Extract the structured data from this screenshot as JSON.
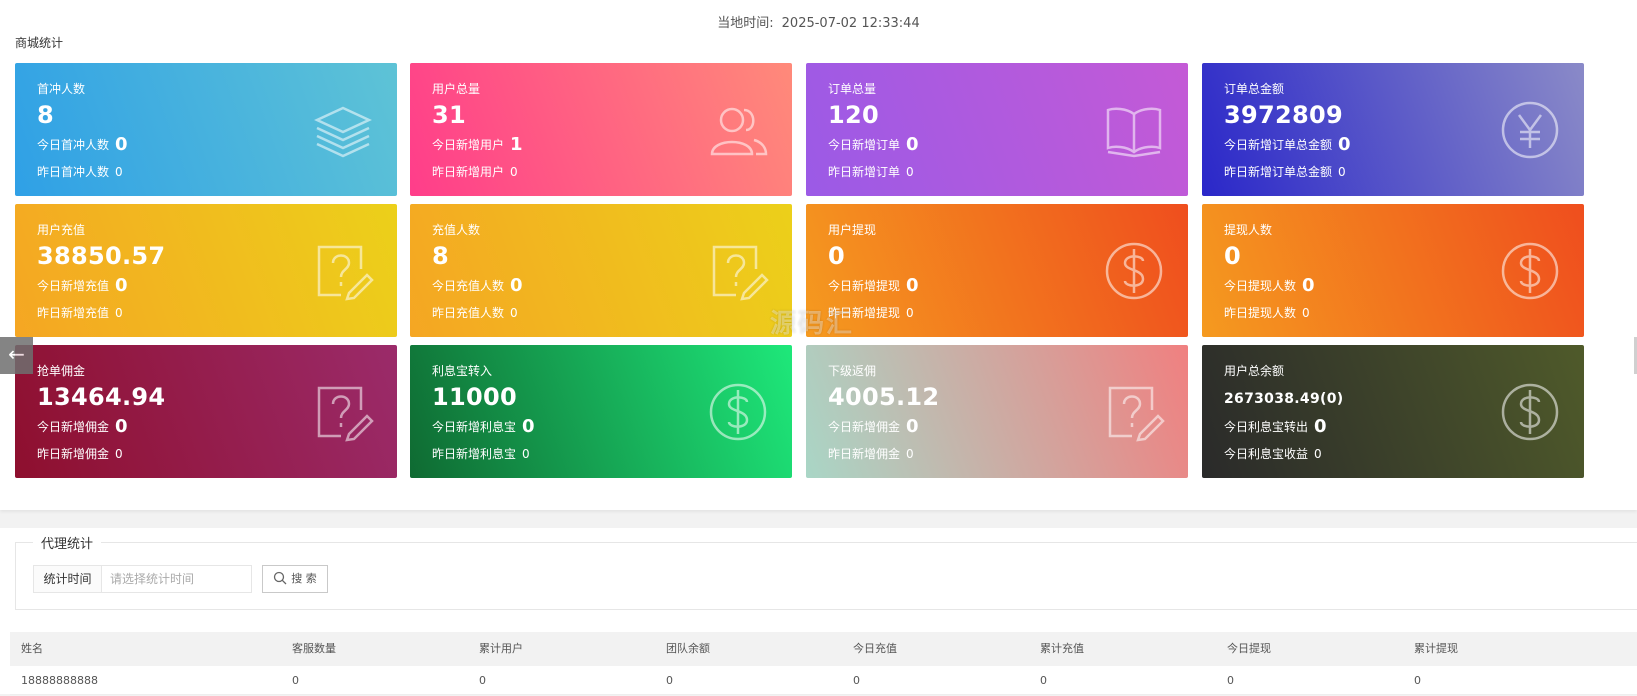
{
  "header": {
    "local_time_label": "当地时间:",
    "local_time_value": "2025-07-02 12:33:44",
    "section_title": "商城统计"
  },
  "cards": [
    {
      "title": "首冲人数",
      "value": "8",
      "line1_label": "今日首冲人数",
      "line1_value": "0",
      "line2_label": "昨日首冲人数",
      "line2_value": "0",
      "icon": "layers-icon",
      "gradient": [
        "#2fa0e6",
        "#5ec3d6"
      ]
    },
    {
      "title": "用户总量",
      "value": "31",
      "line1_label": "今日新增用户",
      "line1_value": "1",
      "line2_label": "昨日新增用户",
      "line2_value": "0",
      "icon": "users-icon",
      "gradient": [
        "#ff3d8a",
        "#ff8a7a"
      ]
    },
    {
      "title": "订单总量",
      "value": "120",
      "line1_label": "今日新增订单",
      "line1_value": "0",
      "line2_label": "昨日新增订单",
      "line2_value": "0",
      "icon": "book-icon",
      "gradient": [
        "#9b5ae6",
        "#c45ad6"
      ]
    },
    {
      "title": "订单总金额",
      "value": "3972809",
      "line1_label": "今日新增订单总金额",
      "line1_value": "0",
      "line2_label": "昨日新增订单总金额",
      "line2_value": "0",
      "icon": "yen-icon",
      "gradient": [
        "#2a27c9",
        "#8a8ac8"
      ]
    },
    {
      "title": "用户充值",
      "value": "38850.57",
      "line1_label": "今日新增充值",
      "line1_value": "0",
      "line2_label": "昨日新增充值",
      "line2_value": "0",
      "icon": "question-edit-icon",
      "gradient": [
        "#f5a623",
        "#ecd01a"
      ]
    },
    {
      "title": "充值人数",
      "value": "8",
      "line1_label": "今日充值人数",
      "line1_value": "0",
      "line2_label": "昨日充值人数",
      "line2_value": "0",
      "icon": "question-edit-icon",
      "gradient": [
        "#f5a623",
        "#ecd01a"
      ]
    },
    {
      "title": "用户提现",
      "value": "0",
      "line1_label": "今日新增提现",
      "line1_value": "0",
      "line2_label": "昨日新增提现",
      "line2_value": "0",
      "icon": "dollar-icon",
      "gradient": [
        "#f59a1f",
        "#ef4e1e"
      ]
    },
    {
      "title": "提现人数",
      "value": "0",
      "line1_label": "今日提现人数",
      "line1_value": "0",
      "line2_label": "昨日提现人数",
      "line2_value": "0",
      "icon": "dollar-icon",
      "gradient": [
        "#f59a1f",
        "#ef4e1e"
      ]
    },
    {
      "title": "抢单佣金",
      "value": "13464.94",
      "line1_label": "今日新增佣金",
      "line1_value": "0",
      "line2_label": "昨日新增佣金",
      "line2_value": "0",
      "icon": "question-edit-icon",
      "gradient": [
        "#8e0f2e",
        "#9b2b6a"
      ]
    },
    {
      "title": "利息宝转入",
      "value": "11000",
      "line1_label": "今日新增利息宝",
      "line1_value": "0",
      "line2_label": "昨日新增利息宝",
      "line2_value": "0",
      "icon": "dollar-icon",
      "gradient": [
        "#0f6a32",
        "#1ee87a"
      ]
    },
    {
      "title": "下级返佣",
      "value": "4005.12",
      "line1_label": "今日新增佣金",
      "line1_value": "0",
      "line2_label": "昨日新增佣金",
      "line2_value": "0",
      "icon": "question-edit-icon",
      "gradient": [
        "#a9d6c6",
        "#f08080"
      ]
    },
    {
      "title": "用户总余额",
      "value": "2673038.49(0)",
      "line1_label": "今日利息宝转出",
      "line1_value": "0",
      "line2_label": "今日利息宝收益",
      "line2_value": "0",
      "icon": "dollar-icon",
      "gradient": [
        "#2a2a2a",
        "#4f5a2a"
      ]
    }
  ],
  "watermark": "源码汇",
  "side_arrow": "←",
  "agent": {
    "legend": "代理统计",
    "form_label": "统计时间",
    "input_placeholder": "请选择统计时间",
    "search_label": "搜 索",
    "columns": [
      "姓名",
      "客服数量",
      "累计用户",
      "团队余额",
      "今日充值",
      "累计充值",
      "今日提现",
      "累计提现"
    ],
    "rows": [
      [
        "18888888888",
        "0",
        "0",
        "0",
        "0",
        "0",
        "0",
        "0"
      ]
    ]
  }
}
